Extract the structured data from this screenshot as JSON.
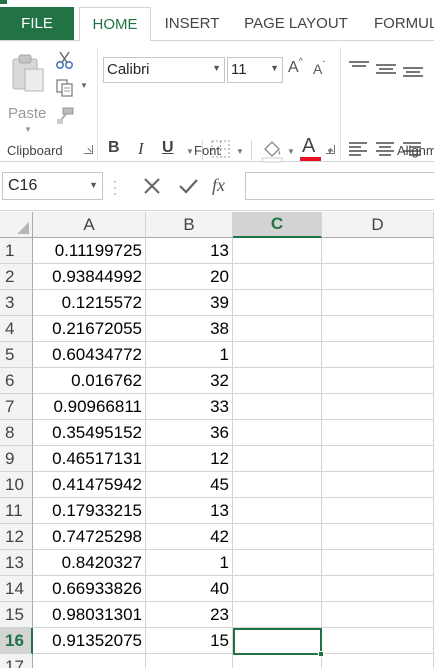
{
  "ribbon_tabs": [
    {
      "label": "FILE"
    },
    {
      "label": "HOME"
    },
    {
      "label": "INSERT"
    },
    {
      "label": "PAGE LAYOUT"
    },
    {
      "label": "FORMUL"
    }
  ],
  "active_tab": "HOME",
  "clipboard": {
    "paste_label": "Paste",
    "group_label": "Clipboard"
  },
  "font": {
    "font_name": "Calibri",
    "font_size": "11",
    "bold_label": "B",
    "italic_label": "I",
    "underline_label": "U",
    "grow_label": "A",
    "shrink_label": "A",
    "font_color_label": "A",
    "font_color": "#e81123",
    "group_label": "Font"
  },
  "alignment": {
    "group_label": "Alignm"
  },
  "formula_bar": {
    "name_box": "C16",
    "fx_label": "fx",
    "formula": ""
  },
  "columns": [
    "A",
    "B",
    "C",
    "D"
  ],
  "selected_column": "C",
  "rows": [
    {
      "num": "1",
      "a": "0.11199725",
      "b": "13"
    },
    {
      "num": "2",
      "a": "0.93844992",
      "b": "20"
    },
    {
      "num": "3",
      "a": "0.1215572",
      "b": "39"
    },
    {
      "num": "4",
      "a": "0.21672055",
      "b": "38"
    },
    {
      "num": "5",
      "a": "0.60434772",
      "b": "1"
    },
    {
      "num": "6",
      "a": "0.016762",
      "b": "32"
    },
    {
      "num": "7",
      "a": "0.90966811",
      "b": "33"
    },
    {
      "num": "8",
      "a": "0.35495152",
      "b": "36"
    },
    {
      "num": "9",
      "a": "0.46517131",
      "b": "12"
    },
    {
      "num": "10",
      "a": "0.41475942",
      "b": "45"
    },
    {
      "num": "11",
      "a": "0.17933215",
      "b": "13"
    },
    {
      "num": "12",
      "a": "0.74725298",
      "b": "42"
    },
    {
      "num": "13",
      "a": "0.8420327",
      "b": "1"
    },
    {
      "num": "14",
      "a": "0.66933826",
      "b": "40"
    },
    {
      "num": "15",
      "a": "0.98031301",
      "b": "23"
    },
    {
      "num": "16",
      "a": "0.91352075",
      "b": "15"
    },
    {
      "num": "17",
      "a": "",
      "b": ""
    }
  ],
  "selected_row": "16",
  "colors": {
    "excel_green": "#217346",
    "header_bg": "#f3f3f3",
    "selected_header_bg": "#d3d3d3",
    "gridline": "#d4d4d4"
  }
}
